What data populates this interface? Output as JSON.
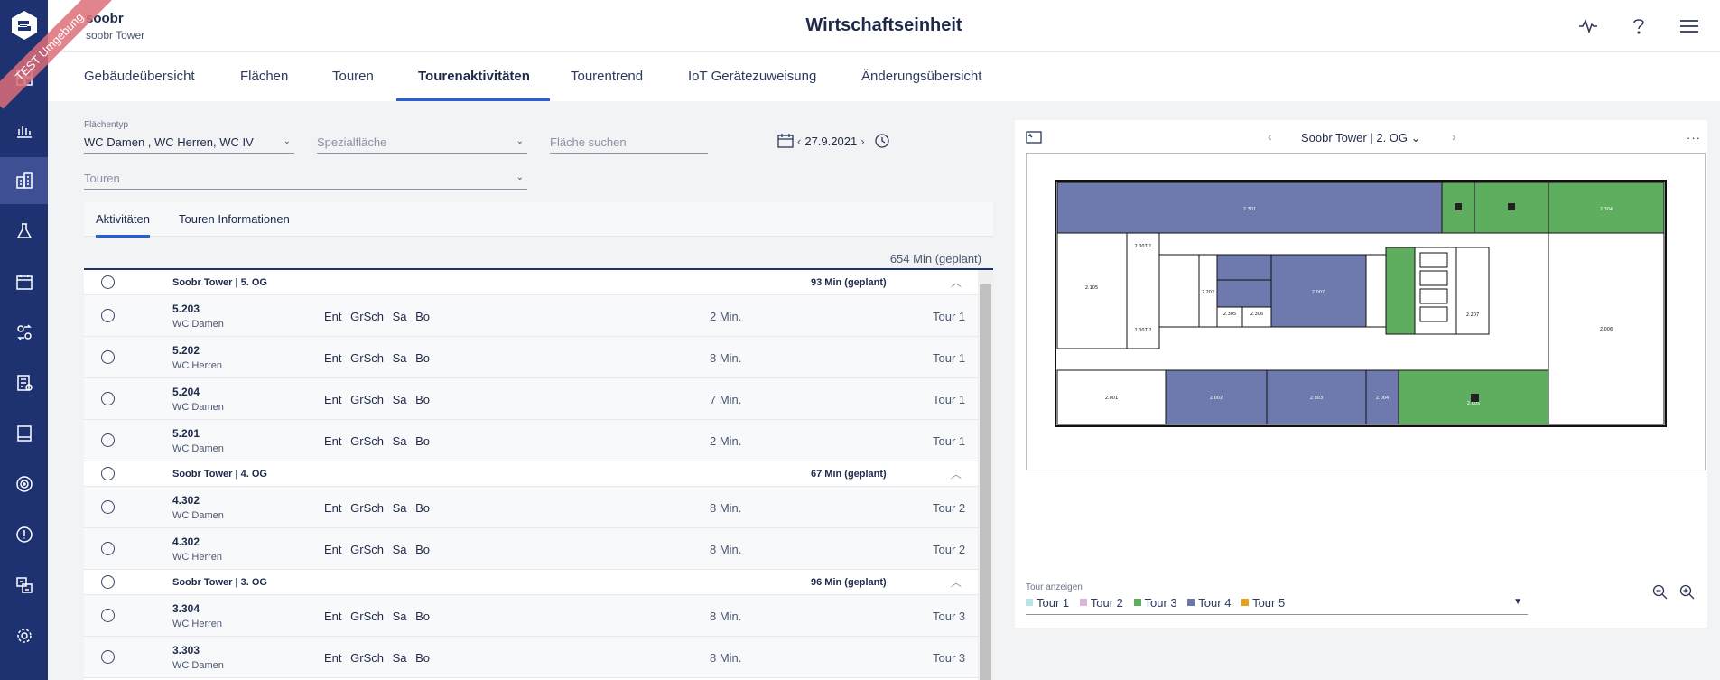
{
  "header": {
    "app_name": "soobr",
    "app_sub": "soobr Tower",
    "title": "Wirtschaftseinheit",
    "ribbon": "TEST Umgebung",
    "icons": [
      "activity-icon",
      "help-icon",
      "menu-icon"
    ]
  },
  "sidebar": {
    "items": [
      "dashboard-icon",
      "chart-icon",
      "buildings-icon",
      "flask-icon",
      "calendar-icon",
      "tour-swap-icon",
      "report-icon",
      "book-icon",
      "sensor-icon",
      "alert-icon",
      "translate-icon",
      "settings-icon"
    ]
  },
  "tabs": [
    "Gebäudeübersicht",
    "Flächen",
    "Touren",
    "Tourenaktivitäten",
    "Tourentrend",
    "IoT Gerätezuweisung",
    "Änderungsübersicht"
  ],
  "filters": {
    "flaechentyp_label": "Flächentyp",
    "flaechentyp_value": "WC Damen , WC Herren, WC IV",
    "spezial_placeholder": "Spezialfläche",
    "search_placeholder": "Fläche suchen",
    "touren_placeholder": "Touren",
    "date": "27.9.2021"
  },
  "panel_tabs": [
    "Aktivitäten",
    "Touren Informationen"
  ],
  "total": "654 Min (geplant)",
  "groups": [
    {
      "title": "Soobr Tower | 5. OG",
      "minutes": "93 Min (geplant)",
      "rows": [
        {
          "id": "5.203",
          "type": "WC Damen",
          "acts": "Ent GrSch Sa Bo",
          "min": "2 Min.",
          "tour": "Tour 1"
        },
        {
          "id": "5.202",
          "type": "WC Herren",
          "acts": "Ent GrSch Sa Bo",
          "min": "8 Min.",
          "tour": "Tour 1"
        },
        {
          "id": "5.204",
          "type": "WC Damen",
          "acts": "Ent GrSch Sa Bo",
          "min": "7 Min.",
          "tour": "Tour 1"
        },
        {
          "id": "5.201",
          "type": "WC Damen",
          "acts": "Ent GrSch Sa Bo",
          "min": "2 Min.",
          "tour": "Tour 1"
        }
      ]
    },
    {
      "title": "Soobr Tower | 4. OG",
      "minutes": "67 Min (geplant)",
      "rows": [
        {
          "id": "4.302",
          "type": "WC Damen",
          "acts": "Ent GrSch Sa Bo",
          "min": "8 Min.",
          "tour": "Tour 2"
        },
        {
          "id": "4.302",
          "type": "WC Herren",
          "acts": "Ent GrSch Sa Bo",
          "min": "8 Min.",
          "tour": "Tour 2"
        }
      ]
    },
    {
      "title": "Soobr Tower | 3. OG",
      "minutes": "96 Min (geplant)",
      "rows": [
        {
          "id": "3.304",
          "type": "WC Herren",
          "acts": "Ent GrSch Sa Bo",
          "min": "8 Min.",
          "tour": "Tour 3"
        },
        {
          "id": "3.303",
          "type": "WC Damen",
          "acts": "Ent GrSch Sa Bo",
          "min": "8 Min.",
          "tour": "Tour 3"
        }
      ]
    }
  ],
  "map": {
    "floor": "Soobr Tower | 2. OG",
    "legend_label": "Tour anzeigen",
    "tours": [
      {
        "name": "Tour 1",
        "color": "#b9e3ea"
      },
      {
        "name": "Tour 2",
        "color": "#d9b8d6"
      },
      {
        "name": "Tour 3",
        "color": "#5fae5f"
      },
      {
        "name": "Tour 4",
        "color": "#6a75aa"
      },
      {
        "name": "Tour 5",
        "color": "#e8a21a"
      }
    ],
    "room_labels": {
      "r2001": "2.001",
      "r2002": "2.002",
      "r2003": "2.003",
      "r2004": "2.004",
      "r2005": "2.005",
      "r2006": "2.006",
      "r2007": "2.007",
      "r2007_1": "2.007.1",
      "r2007_2": "2.007.2",
      "r2105": "2.105",
      "r2202": "2.202",
      "r2207": "2.207",
      "r2305": "2.305",
      "r2306": "2.306",
      "r2301": "2.301",
      "r2304": "2.304"
    }
  }
}
